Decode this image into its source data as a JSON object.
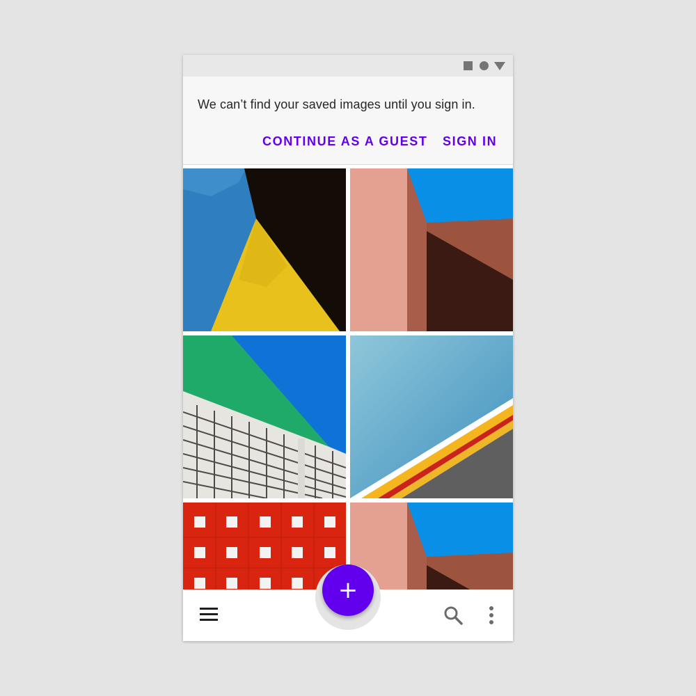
{
  "status_bar": {
    "icons": [
      "stop-square-icon",
      "dot-circle-icon",
      "triangle-down-icon"
    ],
    "icon_color": "#757575"
  },
  "banner": {
    "message": "We can’t find your saved images until you sign in.",
    "guest_button": "CONTINUE AS A GUEST",
    "signin_button": "SIGN IN",
    "accent": "#6200ee"
  },
  "gallery": {
    "images": [
      {
        "subject": "yellow triangular wall against blue sky"
      },
      {
        "subject": "pink wall with brown building and blue sky"
      },
      {
        "subject": "green glass and white facade building"
      },
      {
        "subject": "light blue sky with yellow and red stripes"
      },
      {
        "subject": "red facade with windows"
      },
      {
        "subject": "pink wall with brown building and blue sky"
      }
    ]
  },
  "fab": {
    "label": "+",
    "color": "#6200ee"
  },
  "bottom_bar": {
    "icons": [
      "menu-icon",
      "search-icon",
      "more-vert-icon"
    ]
  }
}
